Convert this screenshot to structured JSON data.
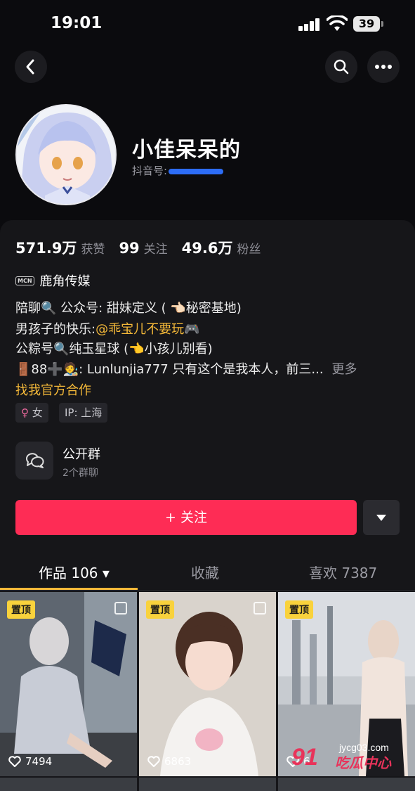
{
  "status_bar": {
    "time": "19:01",
    "battery": "39"
  },
  "profile": {
    "name": "小佳呆呆的",
    "douyin_id_label": "抖音号:"
  },
  "stats": [
    {
      "value": "571.9万",
      "label": "获赞"
    },
    {
      "value": "99",
      "label": "关注"
    },
    {
      "value": "49.6万",
      "label": "粉丝"
    }
  ],
  "mcn": {
    "tag": "MCN",
    "name": "鹿角传媒"
  },
  "bio": {
    "line1": "陪聊🔍 公众号: 甜妹定义 ( 👈🏻秘密基地)",
    "line2_prefix": "男孩子的快乐:",
    "line2_mention": "@乖宝儿不要玩",
    "line2_suffix": "🎮",
    "line3": "公粽号🔍纯玉星球 (👈小孩儿别看)",
    "line4": "🚪88➕🧑‍🎨: Lunlunjia777  只有这个是我本人，前三...",
    "more": "更多",
    "cooperate": "找我官方合作"
  },
  "chips": {
    "gender": "女",
    "ip": "IP: 上海"
  },
  "group": {
    "title": "公开群",
    "subtitle": "2个群聊"
  },
  "actions": {
    "follow": "+ 关注"
  },
  "tabs": [
    {
      "label": "作品 106 ▾",
      "active": true
    },
    {
      "label": "收藏",
      "active": false
    },
    {
      "label": "喜欢 7387",
      "active": false
    }
  ],
  "videos": [
    {
      "pinned": "置顶",
      "likes": "7494"
    },
    {
      "pinned": "置顶",
      "likes": "6863"
    },
    {
      "pinned": "置顶",
      "likes": "6"
    }
  ],
  "watermark": {
    "number": "91",
    "domain": "jycg03.com",
    "text": "吃瓜中心"
  },
  "colors": {
    "accent": "#fe2c55",
    "highlight": "#f5b939",
    "background": "#0b0b0e"
  }
}
